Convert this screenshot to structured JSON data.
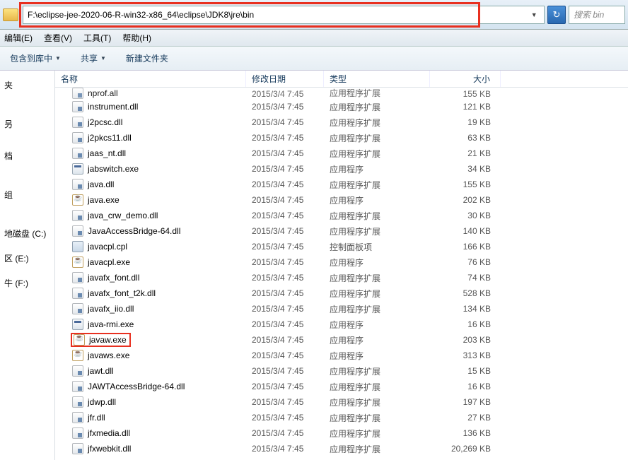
{
  "address": "F:\\eclipse-jee-2020-06-R-win32-x86_64\\eclipse\\JDK8\\jre\\bin",
  "search_placeholder": "搜索 bin",
  "menu": {
    "edit": "编辑(E)",
    "view": "查看(V)",
    "tools": "工具(T)",
    "help": "帮助(H)"
  },
  "toolbar": {
    "include": "包含到库中",
    "share": "共享",
    "newfolder": "新建文件夹"
  },
  "sidebar": {
    "items": [
      "夹",
      "",
      "",
      "",
      "叧",
      "",
      "",
      "档",
      "",
      "",
      "",
      "组",
      "",
      "",
      "",
      "地磁盘 (C:)",
      "",
      "区 (E:)",
      "",
      "牛 (F:)"
    ]
  },
  "columns": {
    "name": "名称",
    "date": "修改日期",
    "type": "类型",
    "size": "大小"
  },
  "highlighted_file": "javaw.exe",
  "files": [
    {
      "name": "nprof.all",
      "date": "2015/3/4 7:45",
      "type": "应用程序扩展",
      "size": "155 KB",
      "icon": "dll"
    },
    {
      "name": "instrument.dll",
      "date": "2015/3/4 7:45",
      "type": "应用程序扩展",
      "size": "121 KB",
      "icon": "dll"
    },
    {
      "name": "j2pcsc.dll",
      "date": "2015/3/4 7:45",
      "type": "应用程序扩展",
      "size": "19 KB",
      "icon": "dll"
    },
    {
      "name": "j2pkcs11.dll",
      "date": "2015/3/4 7:45",
      "type": "应用程序扩展",
      "size": "63 KB",
      "icon": "dll"
    },
    {
      "name": "jaas_nt.dll",
      "date": "2015/3/4 7:45",
      "type": "应用程序扩展",
      "size": "21 KB",
      "icon": "dll"
    },
    {
      "name": "jabswitch.exe",
      "date": "2015/3/4 7:45",
      "type": "应用程序",
      "size": "34 KB",
      "icon": "exe"
    },
    {
      "name": "java.dll",
      "date": "2015/3/4 7:45",
      "type": "应用程序扩展",
      "size": "155 KB",
      "icon": "dll"
    },
    {
      "name": "java.exe",
      "date": "2015/3/4 7:45",
      "type": "应用程序",
      "size": "202 KB",
      "icon": "java"
    },
    {
      "name": "java_crw_demo.dll",
      "date": "2015/3/4 7:45",
      "type": "应用程序扩展",
      "size": "30 KB",
      "icon": "dll"
    },
    {
      "name": "JavaAccessBridge-64.dll",
      "date": "2015/3/4 7:45",
      "type": "应用程序扩展",
      "size": "140 KB",
      "icon": "dll"
    },
    {
      "name": "javacpl.cpl",
      "date": "2015/3/4 7:45",
      "type": "控制面板项",
      "size": "166 KB",
      "icon": "cpl"
    },
    {
      "name": "javacpl.exe",
      "date": "2015/3/4 7:45",
      "type": "应用程序",
      "size": "76 KB",
      "icon": "java"
    },
    {
      "name": "javafx_font.dll",
      "date": "2015/3/4 7:45",
      "type": "应用程序扩展",
      "size": "74 KB",
      "icon": "dll"
    },
    {
      "name": "javafx_font_t2k.dll",
      "date": "2015/3/4 7:45",
      "type": "应用程序扩展",
      "size": "528 KB",
      "icon": "dll"
    },
    {
      "name": "javafx_iio.dll",
      "date": "2015/3/4 7:45",
      "type": "应用程序扩展",
      "size": "134 KB",
      "icon": "dll"
    },
    {
      "name": "java-rmi.exe",
      "date": "2015/3/4 7:45",
      "type": "应用程序",
      "size": "16 KB",
      "icon": "exe"
    },
    {
      "name": "javaw.exe",
      "date": "2015/3/4 7:45",
      "type": "应用程序",
      "size": "203 KB",
      "icon": "java"
    },
    {
      "name": "javaws.exe",
      "date": "2015/3/4 7:45",
      "type": "应用程序",
      "size": "313 KB",
      "icon": "java"
    },
    {
      "name": "jawt.dll",
      "date": "2015/3/4 7:45",
      "type": "应用程序扩展",
      "size": "15 KB",
      "icon": "dll"
    },
    {
      "name": "JAWTAccessBridge-64.dll",
      "date": "2015/3/4 7:45",
      "type": "应用程序扩展",
      "size": "16 KB",
      "icon": "dll"
    },
    {
      "name": "jdwp.dll",
      "date": "2015/3/4 7:45",
      "type": "应用程序扩展",
      "size": "197 KB",
      "icon": "dll"
    },
    {
      "name": "jfr.dll",
      "date": "2015/3/4 7:45",
      "type": "应用程序扩展",
      "size": "27 KB",
      "icon": "dll"
    },
    {
      "name": "jfxmedia.dll",
      "date": "2015/3/4 7:45",
      "type": "应用程序扩展",
      "size": "136 KB",
      "icon": "dll"
    },
    {
      "name": "jfxwebkit.dll",
      "date": "2015/3/4 7:45",
      "type": "应用程序扩展",
      "size": "20,269 KB",
      "icon": "dll"
    }
  ]
}
